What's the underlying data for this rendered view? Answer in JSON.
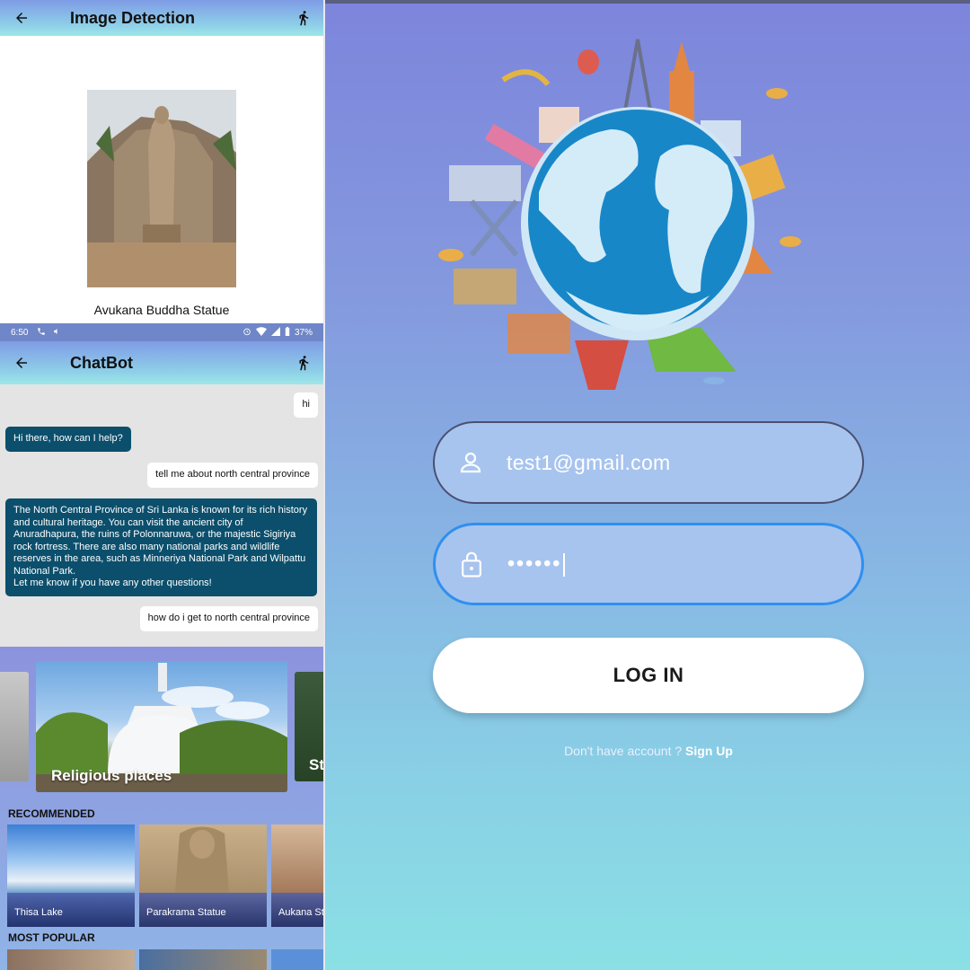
{
  "detection": {
    "title": "Image Detection",
    "caption": "Avukana Buddha Statue"
  },
  "statusbar": {
    "time": "6:50",
    "battery": "37%"
  },
  "chat": {
    "title": "ChatBot",
    "messages": [
      {
        "from": "user",
        "text": "hi"
      },
      {
        "from": "bot",
        "text": "Hi there, how can I help?"
      },
      {
        "from": "user",
        "text": "tell me about north central province"
      },
      {
        "from": "bot",
        "text": "The North Central Province of Sri Lanka is known for its rich history and cultural heritage. You can visit the ancient city of Anuradhapura, the ruins of Polonnaruwa, or the majestic Sigiriya rock fortress. There are also many national parks and wildlife reserves in the area, such as Minneriya National Park and Wilpattu National Park.\n Let me know if you have any other questions!"
      },
      {
        "from": "user",
        "text": "how do i get to north central province"
      }
    ]
  },
  "home": {
    "carousel_main": "Religious places",
    "carousel_next": "St",
    "recommended_header": "RECOMMENDED",
    "popular_header": "MOST POPULAR",
    "recommended": [
      "Thisa Lake",
      "Parakrama Statue",
      "Aukana St"
    ]
  },
  "login": {
    "email_value": "test1@gmail.com",
    "password_value": "••••••",
    "login_label": "LOG IN",
    "signup_prompt": "Don't have account ? ",
    "signup_link": "Sign Up"
  },
  "colors": {
    "appbar_top": "#7f9ce6",
    "appbar_bottom": "#9ee8e8",
    "bot_bubble": "#0b4f6c",
    "focus_border": "#2f8ff0"
  },
  "icons": [
    "back-arrow-icon",
    "running-person-icon",
    "user-icon",
    "lock-icon",
    "phone-icon",
    "alarm-icon",
    "wifi-icon",
    "signal-icon",
    "battery-icon"
  ]
}
